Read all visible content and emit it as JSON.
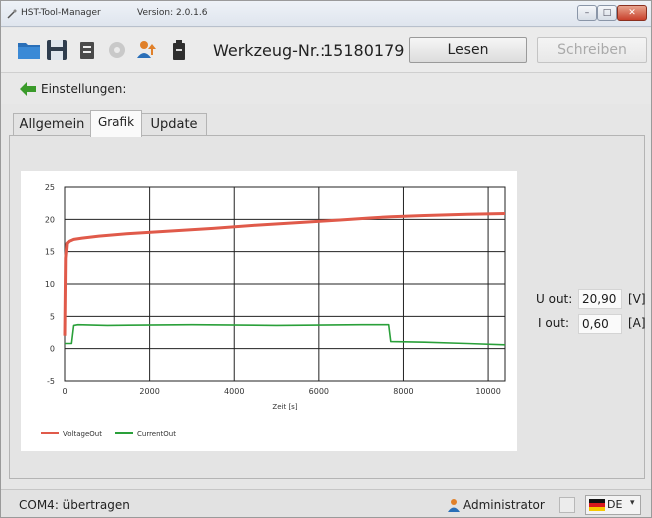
{
  "titlebar": {
    "app_name": "HST-Tool-Manager",
    "version": "Version: 2.0.1.6",
    "minimize": "–",
    "maximize": "□",
    "close": "✕"
  },
  "toolbar": {
    "icons": [
      "folder-icon",
      "save-icon",
      "list-icon",
      "gear-icon",
      "user-upload-icon",
      "battery-icon"
    ],
    "tool_label": "Werkzeug-Nr.:",
    "tool_number": "15180179",
    "read_label": "Lesen",
    "write_label": "Schreiben"
  },
  "settings": {
    "label": "Einstellungen:"
  },
  "tabs": [
    {
      "label": "Allgemein",
      "active": false
    },
    {
      "label": "Grafik",
      "active": true
    },
    {
      "label": "Update",
      "active": false
    }
  ],
  "readouts": {
    "u_label": "U out:",
    "u_value": "20,90",
    "u_unit": "[V]",
    "i_label": "I out:",
    "i_value": "0,60",
    "i_unit": "[A]"
  },
  "statusbar": {
    "status": "COM4: übertragen",
    "user": "Administrator",
    "language": "DE",
    "arrow": "▾"
  },
  "colors": {
    "voltage": "#e05a4a",
    "current": "#2aa03a",
    "grid": "#222222",
    "plot_bg": "#ffffff"
  },
  "chart_data": {
    "type": "line",
    "title": "",
    "xlabel": "Zeit [s]",
    "ylabel": "",
    "xlim": [
      0,
      10400
    ],
    "ylim": [
      -5,
      25
    ],
    "xticks": [
      0,
      2000,
      4000,
      6000,
      8000,
      10000
    ],
    "yticks": [
      -5,
      0,
      5,
      10,
      15,
      20,
      25
    ],
    "grid": true,
    "legend": "bottom-left",
    "series": [
      {
        "name": "VoltageOut",
        "color": "#e05a4a",
        "x": [
          0,
          20,
          50,
          100,
          200,
          400,
          800,
          1500,
          2500,
          3500,
          4500,
          5500,
          6500,
          7200,
          7700,
          8500,
          9500,
          10400
        ],
        "y": [
          2,
          14,
          16.3,
          16.6,
          16.9,
          17.1,
          17.4,
          17.8,
          18.2,
          18.6,
          19.1,
          19.5,
          19.9,
          20.2,
          20.4,
          20.6,
          20.8,
          20.9
        ]
      },
      {
        "name": "CurrentOut",
        "color": "#2aa03a",
        "x": [
          0,
          150,
          200,
          300,
          1000,
          3000,
          5000,
          7000,
          7650,
          7700,
          8500,
          9500,
          10400
        ],
        "y": [
          0.8,
          0.8,
          3.6,
          3.7,
          3.6,
          3.7,
          3.6,
          3.7,
          3.7,
          1.1,
          1.0,
          0.8,
          0.6
        ]
      }
    ]
  }
}
